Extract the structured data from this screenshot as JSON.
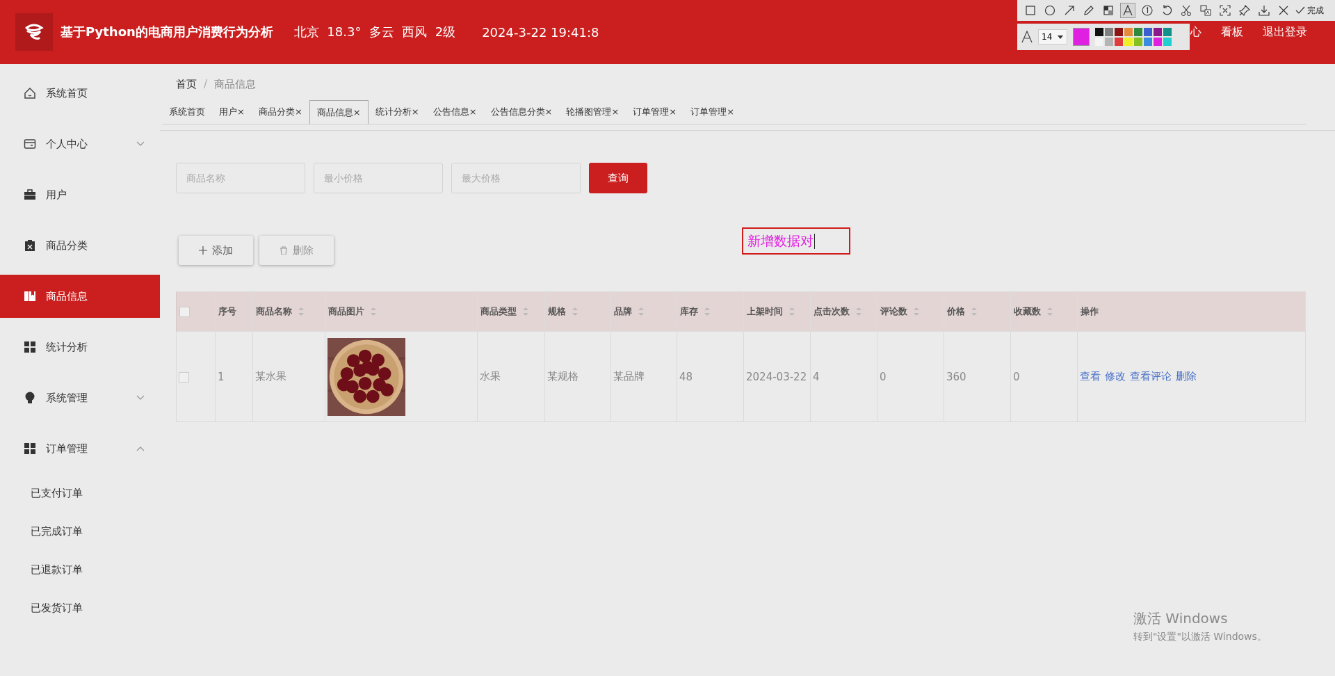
{
  "header": {
    "title": "基于Python的电商用户消费行为分析",
    "weather": "北京  18.3°  多云  西风  2级",
    "datetime": "2024-3-22 19:41:8",
    "nav": [
      "心",
      "看板",
      "退出登录"
    ]
  },
  "sidebar": {
    "items": [
      {
        "label": "系统首页",
        "kind": "home",
        "selected": false
      },
      {
        "label": "个人中心",
        "kind": "wallet",
        "selected": false,
        "expanded": false
      },
      {
        "label": "用户",
        "kind": "briefcase",
        "selected": false
      },
      {
        "label": "商品分类",
        "kind": "clipboard",
        "selected": false
      },
      {
        "label": "商品信息",
        "kind": "book",
        "selected": true
      },
      {
        "label": "统计分析",
        "kind": "grid",
        "selected": false
      },
      {
        "label": "系统管理",
        "kind": "bulb",
        "selected": false,
        "expanded": false
      },
      {
        "label": "订单管理",
        "kind": "grid",
        "selected": false,
        "expanded": true,
        "children": [
          {
            "label": "已支付订单"
          },
          {
            "label": "已完成订单"
          },
          {
            "label": "已退款订单"
          },
          {
            "label": "已发货订单"
          }
        ]
      }
    ]
  },
  "breadcrumb": [
    "首页",
    "商品信息"
  ],
  "breadcrumb_separator": "/",
  "tabs": [
    {
      "label": "系统首页",
      "closable": false,
      "selected": false
    },
    {
      "label": "用户",
      "closable": true,
      "selected": false
    },
    {
      "label": "商品分类",
      "closable": true,
      "selected": false
    },
    {
      "label": "商品信息",
      "closable": true,
      "selected": true
    },
    {
      "label": "统计分析",
      "closable": true,
      "selected": false
    },
    {
      "label": "公告信息",
      "closable": true,
      "selected": false
    },
    {
      "label": "公告信息分类",
      "closable": true,
      "selected": false
    },
    {
      "label": "轮播图管理",
      "closable": true,
      "selected": false
    },
    {
      "label": "订单管理",
      "closable": true,
      "selected": false
    },
    {
      "label": "订单管理",
      "closable": true,
      "selected": false
    }
  ],
  "close_mark": "×",
  "search": {
    "fields": [
      {
        "placeholder": "商品名称"
      },
      {
        "placeholder": "最小价格"
      },
      {
        "placeholder": "最大价格"
      }
    ],
    "button": "查询"
  },
  "actions": [
    {
      "label": "添加",
      "kind": "plus"
    },
    {
      "label": "删除",
      "kind": "trash"
    }
  ],
  "table": {
    "columns": [
      {
        "kind": "check"
      },
      {
        "label": "序号",
        "sortable": false
      },
      {
        "label": "商品名称",
        "sortable": true
      },
      {
        "label": "商品图片",
        "sortable": true
      },
      {
        "label": "商品类型",
        "sortable": true
      },
      {
        "label": "规格",
        "sortable": true
      },
      {
        "label": "品牌",
        "sortable": true
      },
      {
        "label": "库存",
        "sortable": true
      },
      {
        "label": "上架时间",
        "sortable": true
      },
      {
        "label": "点击次数",
        "sortable": true
      },
      {
        "label": "评论数",
        "sortable": true
      },
      {
        "label": "价格",
        "sortable": true
      },
      {
        "label": "收藏数",
        "sortable": true
      },
      {
        "label": "操作",
        "sortable": false
      }
    ],
    "header_checked": false,
    "rows": [
      {
        "cells": [
          {
            "kind": "check",
            "checked": false
          },
          "1",
          "某水果",
          {
            "kind": "picture"
          },
          "水果",
          "某规格",
          "某品牌",
          "48",
          "2024-03-22",
          "4",
          "0",
          "360",
          "0",
          {
            "kind": "links",
            "links": [
              "查看",
              "修改",
              "查看评论",
              "删除"
            ]
          }
        ]
      }
    ]
  },
  "annotation": {
    "text": "新增数据对",
    "color": "#e020e0"
  },
  "capture_toolbar": {
    "tools": [
      {
        "kind": "rect",
        "selected": false
      },
      {
        "kind": "circle",
        "selected": false
      },
      {
        "kind": "arrow",
        "selected": false
      },
      {
        "kind": "pencil",
        "selected": false
      },
      {
        "kind": "mosaic",
        "selected": false
      },
      {
        "kind": "text",
        "selected": true
      },
      {
        "kind": "number",
        "selected": false
      },
      {
        "kind": "undo",
        "selected": false
      },
      {
        "kind": "scissors",
        "selected": false
      },
      {
        "kind": "translate",
        "selected": false
      },
      {
        "kind": "scan",
        "selected": false
      },
      {
        "kind": "pin",
        "selected": false
      },
      {
        "kind": "download",
        "selected": false
      },
      {
        "kind": "close",
        "selected": false
      }
    ],
    "done": "完成",
    "font_size": "14",
    "palette": [
      {
        "color": "#111111",
        "selected": false
      },
      {
        "color": "#808080",
        "selected": false
      },
      {
        "color": "#8b1414",
        "selected": false
      },
      {
        "color": "#e68a3c",
        "selected": false
      },
      {
        "color": "#2e8a3c",
        "selected": false
      },
      {
        "color": "#3a5fd0",
        "selected": false
      },
      {
        "color": "#8a1a8a",
        "selected": false
      },
      {
        "color": "#12908a",
        "selected": false
      },
      {
        "color": "#f4f4f4",
        "selected": false
      },
      {
        "color": "#b4b4b4",
        "selected": false
      },
      {
        "color": "#e03c3c",
        "selected": false
      },
      {
        "color": "#f0f020",
        "selected": false
      },
      {
        "color": "#86c020",
        "selected": false
      },
      {
        "color": "#3a8ce0",
        "selected": false
      },
      {
        "color": "#e020e0",
        "selected": true
      },
      {
        "color": "#20d0d0",
        "selected": false
      }
    ]
  },
  "os_notice": {
    "title": "激活 Windows",
    "subtitle": "转到\"设置\"以激活 Windows。"
  }
}
